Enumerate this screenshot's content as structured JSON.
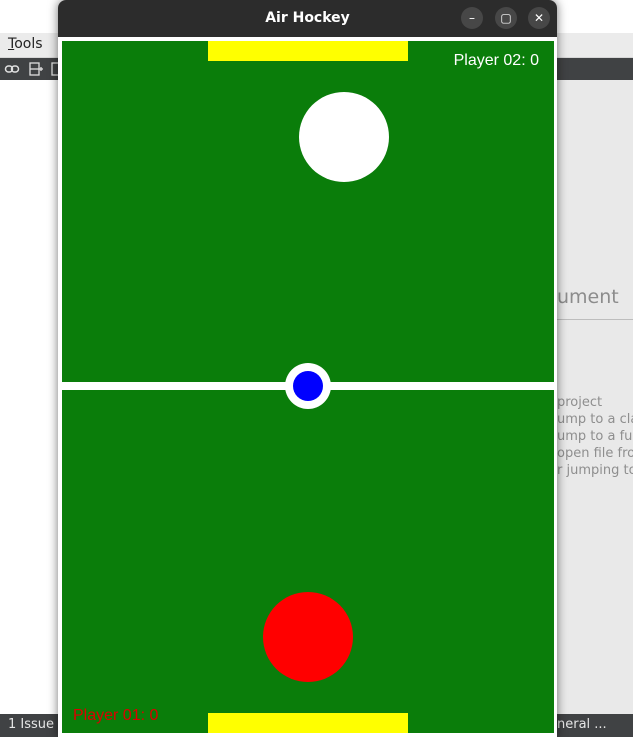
{
  "ide": {
    "menu": {
      "tools_first": "T",
      "tools_rest": "ools"
    },
    "welcome_title": "ument",
    "hints": [
      "project",
      "ump to a clas",
      "ump to a fun",
      "open file fro",
      "r jumping to"
    ],
    "status": {
      "issues": "1  Issue",
      "general": "neral ..."
    }
  },
  "window": {
    "title": "Air Hockey",
    "minimize_glyph": "–",
    "maximize_glyph": "▢",
    "close_glyph": "✕"
  },
  "game": {
    "player2": {
      "label": "Player 02: 0",
      "score": 0,
      "mallet_color": "#ffffff"
    },
    "player1": {
      "label": "Player 01: 0",
      "score": 0,
      "mallet_color": "#ff0000"
    },
    "puck_color": "#0000ff",
    "field_color": "#0a7d0a",
    "goal_color": "#ffff00"
  },
  "icons": {
    "link": "link-icon",
    "split": "split-add-icon"
  }
}
